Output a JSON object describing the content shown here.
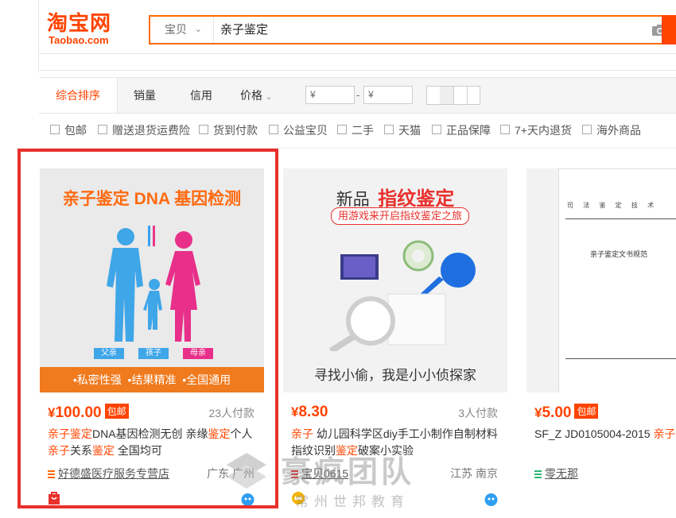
{
  "logo": {
    "cn": "淘宝网",
    "en": "Taobao.com"
  },
  "search": {
    "type_label": "宝贝",
    "query": "亲子鉴定"
  },
  "sort": {
    "items": [
      "综合排序",
      "销量",
      "信用",
      "价格"
    ],
    "price_from_placeholder": "¥",
    "price_to_placeholder": "¥",
    "dash": "-"
  },
  "filters": [
    "包邮",
    "赠送退货运费险",
    "货到付款",
    "公益宝贝",
    "二手",
    "天猫",
    "正品保障",
    "7+天内退货",
    "海外商品"
  ],
  "products": [
    {
      "image_headline": "亲子鉴定 DNA 基因检测",
      "image_labels": [
        "父亲",
        "孩子",
        "母亲"
      ],
      "image_footer": "•私密性强  •结果精准  •全国通用",
      "price_symbol": "¥",
      "price": "100.00",
      "tag": "包邮",
      "sales": "23人付款",
      "title_parts": [
        {
          "t": "亲子鉴定",
          "hl": true
        },
        {
          "t": "DNA基因检测无创 亲缘",
          "hl": false
        },
        {
          "t": "鉴定",
          "hl": true
        },
        {
          "t": "个人",
          "hl": false
        },
        {
          "t": "亲子",
          "hl": true
        },
        {
          "t": "关系",
          "hl": false
        },
        {
          "t": "鉴定",
          "hl": true
        },
        {
          "t": " 全国均可",
          "hl": false
        }
      ],
      "shop": "好德盛医疗服务专营店",
      "location": "广东 广州"
    },
    {
      "image_headline_a": "新品",
      "image_headline_b": "指纹鉴定",
      "image_sub": "用游戏来开启指纹鉴定之旅",
      "image_caption": "寻找小偷，我是小小侦探家",
      "price_symbol": "¥",
      "price": "8.30",
      "sales": "3人付款",
      "title_parts": [
        {
          "t": "亲子",
          "hl": true
        },
        {
          "t": " 幼儿园科学区diy手工小制作自制材料",
          "hl": false
        },
        {
          "t": "指纹识别",
          "hl": false
        },
        {
          "t": "鉴定",
          "hl": true
        },
        {
          "t": "破案小实验",
          "hl": false
        }
      ],
      "shop": "宝贝0615",
      "location": "江苏 南京"
    },
    {
      "doc_title": "司 法 鉴 定 技 术",
      "doc_heading": "亲子鉴定文书规范",
      "price_symbol": "¥",
      "price": "5.00",
      "tag": "包邮",
      "title_parts": [
        {
          "t": "SF_Z JD0105004-2015 ",
          "hl": false
        },
        {
          "t": "亲子鉴",
          "hl": true
        }
      ],
      "shop": "零无那"
    }
  ],
  "watermark": {
    "main": "豪疯团队",
    "sub": "常州世邦教育"
  },
  "colors": {
    "accent": "#ff4400",
    "frame": "#e8302c"
  }
}
